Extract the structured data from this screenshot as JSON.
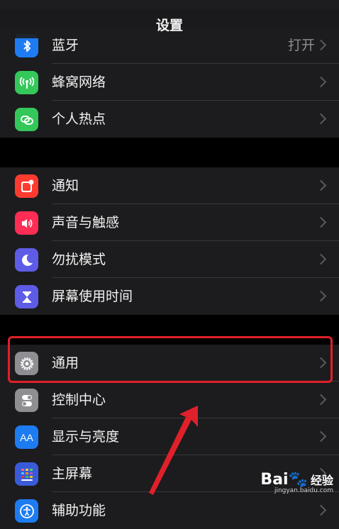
{
  "nav": {
    "title": "设置"
  },
  "group_connect": [
    {
      "label": "蓝牙",
      "value": "打开",
      "icon": "bluetooth-icon",
      "color": "#1e7cf2"
    },
    {
      "label": "蜂窝网络",
      "value": "",
      "icon": "antenna-icon",
      "color": "#34c759"
    },
    {
      "label": "个人热点",
      "value": "",
      "icon": "hotspot-icon",
      "color": "#34c759"
    }
  ],
  "group_notify": [
    {
      "label": "通知",
      "value": "",
      "icon": "notification-icon",
      "color": "#ff3b30"
    },
    {
      "label": "声音与触感",
      "value": "",
      "icon": "speaker-icon",
      "color": "#ff2d55"
    },
    {
      "label": "勿扰模式",
      "value": "",
      "icon": "moon-icon",
      "color": "#5e5ce6"
    },
    {
      "label": "屏幕使用时间",
      "value": "",
      "icon": "hourglass-icon",
      "color": "#5e5ce6"
    }
  ],
  "group_general": [
    {
      "label": "通用",
      "value": "",
      "icon": "gear-icon",
      "color": "#8e8e93"
    },
    {
      "label": "控制中心",
      "value": "",
      "icon": "toggles-icon",
      "color": "#8e8e93"
    },
    {
      "label": "显示与亮度",
      "value": "",
      "icon": "text-size-icon",
      "color": "#1e7cf2"
    },
    {
      "label": "主屏幕",
      "value": "",
      "icon": "home-grid-icon",
      "color": "#3a5bd9"
    },
    {
      "label": "辅助功能",
      "value": "",
      "icon": "accessibility-icon",
      "color": "#1e7cf2"
    }
  ],
  "watermark": {
    "brand": "Bai",
    "brand_suffix": "经验",
    "site": "jingyan.baidu.com"
  }
}
